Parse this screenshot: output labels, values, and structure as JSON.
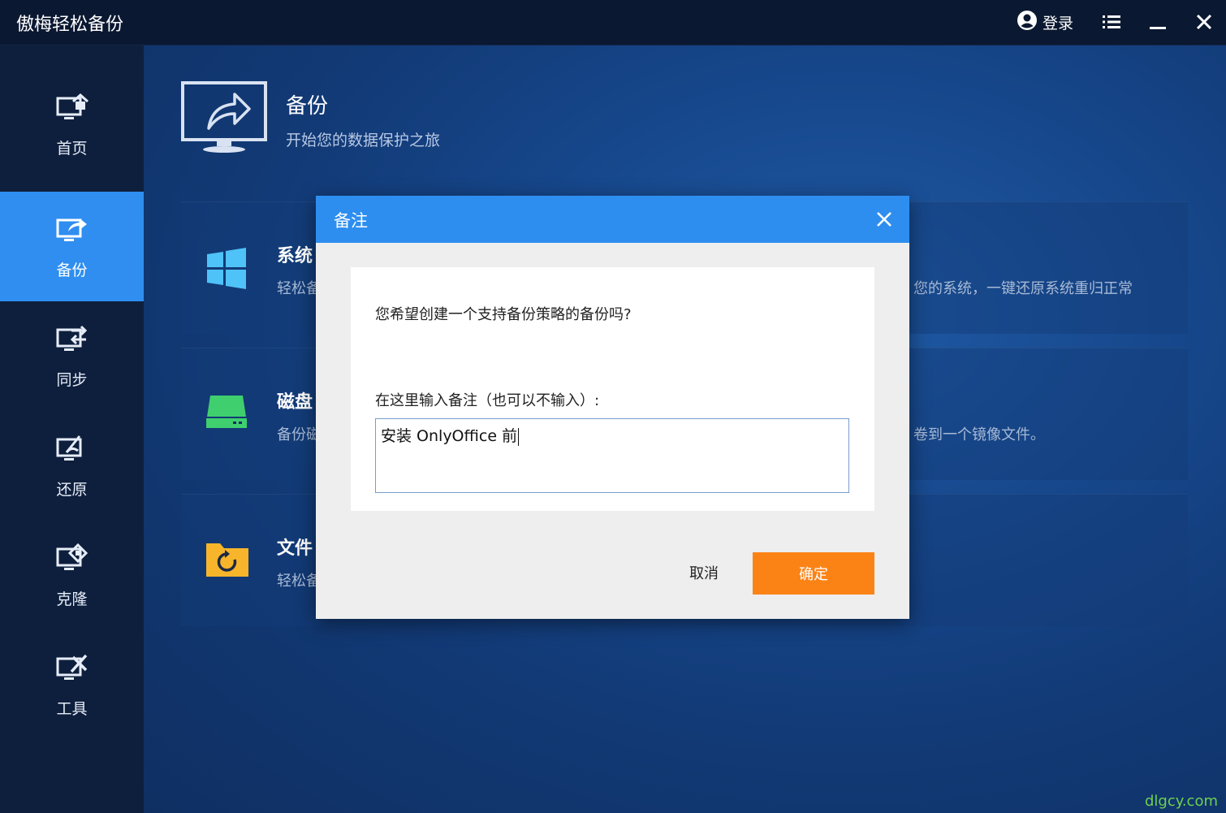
{
  "window": {
    "title": "傲梅轻松备份",
    "login_label": "登录",
    "menu_icon": "menu-icon",
    "minimize_icon": "minimize-icon",
    "close_icon": "close-icon"
  },
  "sidebar": {
    "items": [
      {
        "label": "首页",
        "icon": "home-monitor-icon"
      },
      {
        "label": "备份",
        "icon": "backup-monitor-icon",
        "active": true
      },
      {
        "label": "同步",
        "icon": "sync-monitor-icon"
      },
      {
        "label": "还原",
        "icon": "restore-monitor-icon"
      },
      {
        "label": "克隆",
        "icon": "clone-monitor-icon"
      },
      {
        "label": "工具",
        "icon": "tools-monitor-icon"
      }
    ]
  },
  "main": {
    "title": "备份",
    "subtitle": "开始您的数据保护之旅",
    "cards": [
      {
        "title": "系统",
        "desc": "轻松备",
        "desc_right": "您的系统，一键还原系统重归正常",
        "icon": "windows-icon"
      },
      {
        "title": "磁盘",
        "desc": "备份磁",
        "desc_right": "卷到一个镜像文件。",
        "icon": "disk-icon"
      },
      {
        "title": "文件",
        "desc": "轻松备",
        "desc_right": "",
        "icon": "folder-sync-icon"
      }
    ]
  },
  "dialog": {
    "title": "备注",
    "question": "您希望创建一个支持备份策略的备份吗?",
    "note_label": "在这里输入备注（也可以不输入）:",
    "note_value": "安装 OnlyOffice 前",
    "cancel_label": "取消",
    "ok_label": "确定"
  },
  "watermark": "dlgcy.com",
  "colors": {
    "accent": "#2e8ef0",
    "ok_button": "#fb8316",
    "sidebar": "#0e1f3d",
    "titlebar": "#0b1831"
  }
}
